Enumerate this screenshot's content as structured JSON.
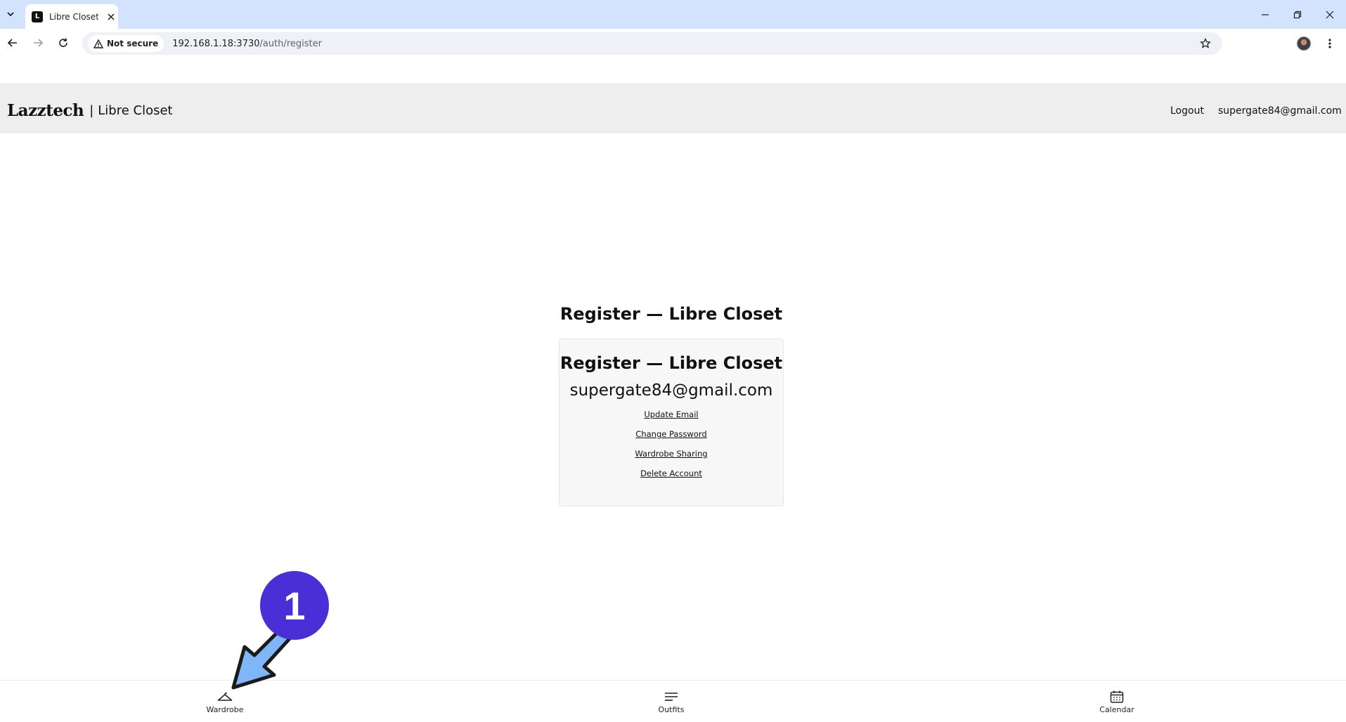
{
  "browser": {
    "tab": {
      "title": "Libre Closet",
      "favicon_letter": "L"
    },
    "security_label": "Not secure",
    "url_host": "192.168.1.18:3730",
    "url_path": "/auth/register"
  },
  "header": {
    "brand_logo": "Lazztech",
    "separator": "|",
    "brand_name": "Libre Closet",
    "logout_label": "Logout",
    "user_email": "supergate84@gmail.com"
  },
  "main": {
    "page_title": "Register — Libre Closet",
    "card": {
      "title": "Register — Libre Closet",
      "email": "supergate84@gmail.com",
      "links": [
        "Update Email",
        "Change Password",
        "Wardrobe Sharing",
        "Delete Account"
      ]
    }
  },
  "bottom_nav": {
    "items": [
      {
        "label": "Wardrobe",
        "icon": "hanger-icon"
      },
      {
        "label": "Outfits",
        "icon": "list-icon"
      },
      {
        "label": "Calendar",
        "icon": "calendar-icon"
      }
    ]
  },
  "annotation": {
    "step": "1",
    "badge_color": "#4a2fd6",
    "arrow_color": "#7eb6f7"
  }
}
